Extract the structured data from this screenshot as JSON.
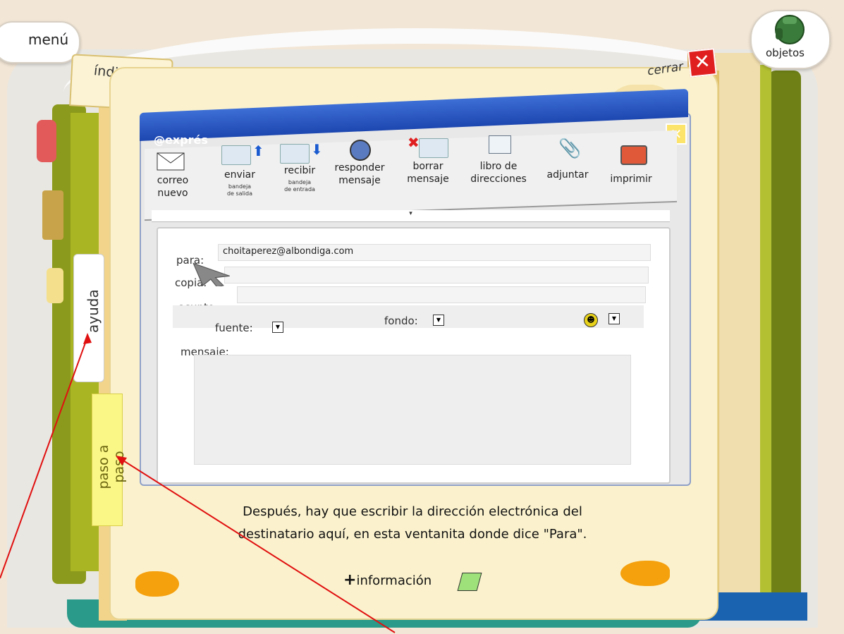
{
  "menu": {
    "label": "menú"
  },
  "objetos": {
    "label": "objetos"
  },
  "indice": {
    "label": "índice"
  },
  "cerrar": {
    "label": "cerrar"
  },
  "side_tabs": {
    "ayuda": "ayuda",
    "paso": "paso a paso"
  },
  "window": {
    "title": "@exprés"
  },
  "toolbar": {
    "correo": [
      "correo",
      "nuevo"
    ],
    "enviar": {
      "label": "enviar",
      "sub": [
        "bandeja",
        "de salida"
      ]
    },
    "recibir": {
      "label": "recibir",
      "sub": [
        "bandeja",
        "de entrada"
      ]
    },
    "responder": [
      "responder",
      "mensaje"
    ],
    "borrar": [
      "borrar",
      "mensaje"
    ],
    "libro": [
      "libro de",
      "direcciones"
    ],
    "adjuntar": "adjuntar",
    "imprimir": "imprimir"
  },
  "form": {
    "para_label": "para:",
    "para_value": "choitaperez@albondiga.com",
    "copia_label": "copia:",
    "asunto_label": "asunto:",
    "fuente_label": "fuente:",
    "fondo_label": "fondo:",
    "mensaje_label": "mensaje:"
  },
  "caption": [
    "Después, hay que escribir la dirección electrónica del",
    "destinatario aquí, en esta ventanita donde dice \"Para\"."
  ],
  "info": {
    "plus": "+",
    "label": "información"
  },
  "colors": {
    "accent_title": "#1d47b0",
    "close_red": "#e02020",
    "arrow_orange": "#f5a00d",
    "annotation_red": "#e01010"
  }
}
